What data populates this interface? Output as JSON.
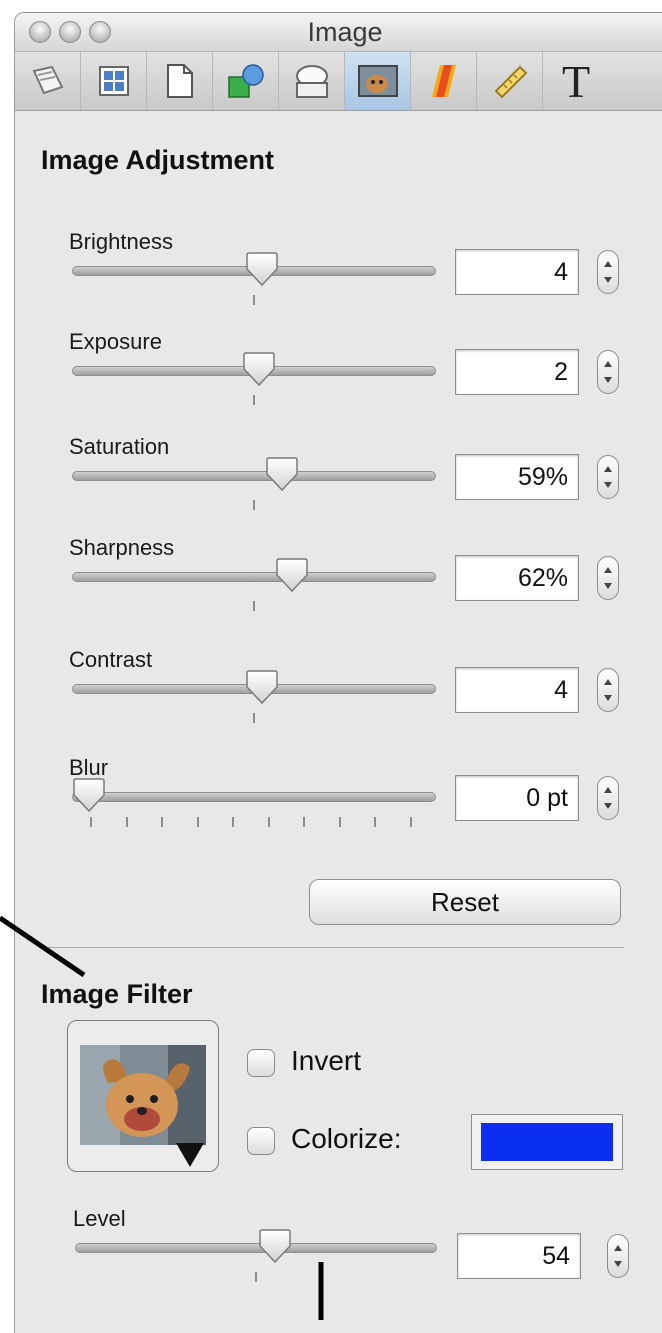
{
  "window": {
    "title": "Image"
  },
  "toolbar": {
    "items": [
      {
        "icon": "document-inspector-icon"
      },
      {
        "icon": "layout-grid-icon"
      },
      {
        "icon": "page-icon"
      },
      {
        "icon": "shapes-icon"
      },
      {
        "icon": "speech-bubble-icon"
      },
      {
        "icon": "image-icon",
        "active": true
      },
      {
        "icon": "color-icon"
      },
      {
        "icon": "ruler-icon"
      },
      {
        "icon": "text-icon",
        "glyph": "T"
      }
    ]
  },
  "adjustment": {
    "title": "Image Adjustment",
    "sliders": [
      {
        "label": "Brightness",
        "value": "4",
        "position": 0.52
      },
      {
        "label": "Exposure",
        "value": "2",
        "position": 0.51
      },
      {
        "label": "Saturation",
        "value": "59%",
        "position": 0.58
      },
      {
        "label": "Sharpness",
        "value": "62%",
        "position": 0.61
      },
      {
        "label": "Contrast",
        "value": "4",
        "position": 0.52
      },
      {
        "label": "Blur",
        "value": "0 pt",
        "position": 0.0
      }
    ],
    "reset_label": "Reset"
  },
  "filter": {
    "title": "Image Filter",
    "invert_label": "Invert",
    "colorize_label": "Colorize:",
    "colorize_color": "#0a2ff0",
    "level_label": "Level",
    "level_value": "54",
    "level_position": 0.55
  }
}
